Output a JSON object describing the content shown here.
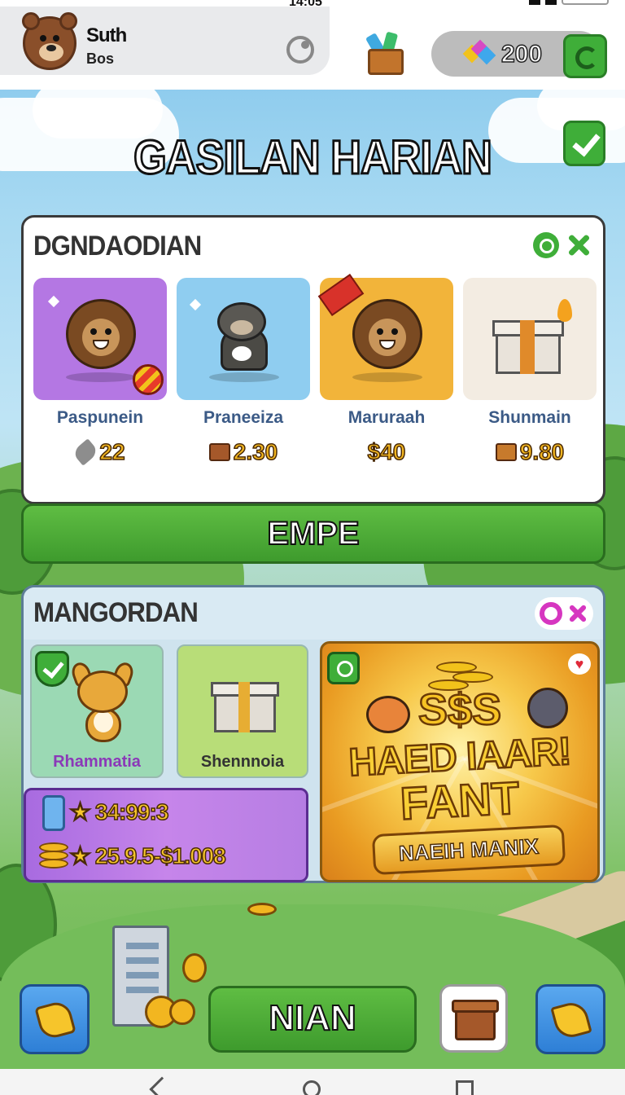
{
  "status_bar": {
    "time": "14:05"
  },
  "profile": {
    "name": "Suth",
    "rank": "Bos"
  },
  "currency": {
    "gems": "200"
  },
  "screen_title": "GASILAN HARIAN",
  "daily_panel": {
    "title": "DGNDAODIAN",
    "items": [
      {
        "name": "Paspunein",
        "price": "22",
        "price_icon": "feather-icon",
        "bg": "#b477e3"
      },
      {
        "name": "Praneeiza",
        "price": "2.30",
        "price_icon": "chest-icon",
        "bg": "#8fcdf0"
      },
      {
        "name": "Maruraah",
        "price": "$40",
        "price_icon": "",
        "bg": "#f2b43a"
      },
      {
        "name": "Shunmain",
        "price": "9.80",
        "price_icon": "gift-icon",
        "bg": "#f3ece2"
      }
    ],
    "action_label": "EMPE"
  },
  "offer_panel": {
    "title": "MANGORDAN",
    "cards": [
      {
        "name": "Rhammatia",
        "color": "#8b39b8",
        "bg": "#9bd9b4"
      },
      {
        "name": "Shennnoia",
        "color": "#333333",
        "bg": "#b8dd78"
      }
    ],
    "stats": [
      {
        "value": "★ 34:99:3",
        "icon": "potion-icon"
      },
      {
        "value": "★ 25.9.5-$1.008",
        "icon": "coin-stack-icon"
      }
    ],
    "promo": {
      "headline": "S$S",
      "line1": "HAED IAAR!",
      "line2": "FANT",
      "button": "NAEIH MANIX"
    }
  },
  "bottom": {
    "main_label": "NIAN"
  },
  "colors": {
    "accent_green": "#3fae39",
    "gold": "#f2b620",
    "panel_border": "#3a3a3a"
  }
}
